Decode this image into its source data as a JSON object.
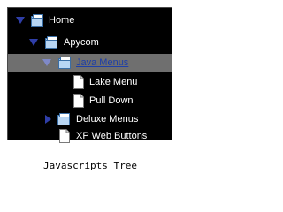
{
  "tree": {
    "items": [
      {
        "label": "Home",
        "icon": "folder-open-icon",
        "expander": "expanded"
      },
      {
        "label": "Apycom",
        "icon": "folder-open-icon",
        "expander": "expanded"
      },
      {
        "label": "Java Menus",
        "icon": "folder-open-icon",
        "expander": "expanded",
        "selected": true
      },
      {
        "label": "Lake Menu",
        "icon": "page-icon"
      },
      {
        "label": "Pull Down",
        "icon": "page-icon"
      },
      {
        "label": "Deluxe Menus",
        "icon": "folder-icon",
        "expander": "collapsed"
      },
      {
        "label": "XP Web Buttons",
        "icon": "page-icon"
      }
    ]
  },
  "caption": "Javascripts Tree",
  "colors": {
    "panel_bg": "#000000",
    "selected_bg": "#6f6f6f",
    "selected_text": "#1e3fa8",
    "text": "#ffffff",
    "arrow": "#2f3ea8"
  }
}
